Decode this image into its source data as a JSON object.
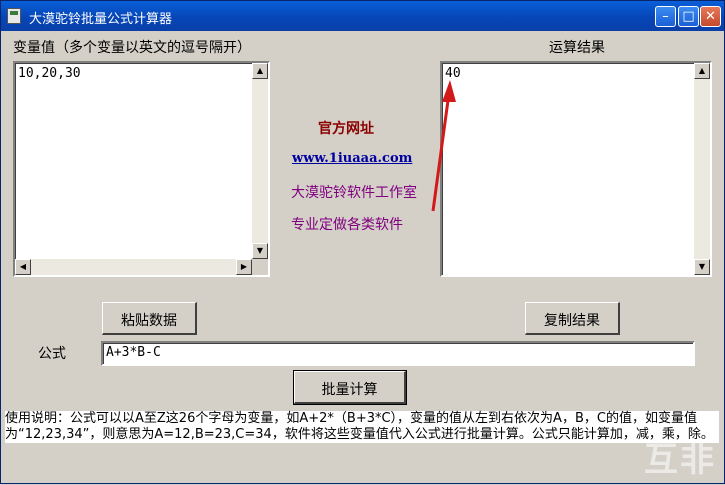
{
  "window": {
    "title": "大漠驼铃批量公式计算器",
    "minimize": "–",
    "maximize": "□",
    "close": "✕"
  },
  "variables": {
    "label": "变量值（多个变量以英文的逗号隔开）",
    "value": "10,20,30"
  },
  "result": {
    "label": "运算结果",
    "value": "40"
  },
  "links": {
    "title": "官方网址",
    "url": "www.1iuaaa.com",
    "studio": "大漠驼铃软件工作室",
    "slogan": "专业定做各类软件"
  },
  "buttons": {
    "paste": "粘贴数据",
    "copy": "复制结果",
    "calculate": "批量计算"
  },
  "formula": {
    "label": "公式",
    "value": "A+3*B-C"
  },
  "instructions": "使用说明：公式可以以A至Z这26个字母为变量，如A+2*（B+3*C），变量的值从左到右依次为A，B，C的值，如变量值为“12,23,34”，则意思为A=12,B=23,C=34，软件将这些变量值代入公式进行批量计算。公式只能计算加，减，乘，除。",
  "watermark": "互非",
  "scroll": {
    "up": "▲",
    "down": "▼",
    "left": "◀",
    "right": "▶"
  },
  "colors": {
    "titlebar": "#0a5fd8",
    "annotation_arrow": "#d21a1a",
    "link_title": "#8b0000",
    "link_url": "#0000a0",
    "link_purple": "#800080"
  }
}
